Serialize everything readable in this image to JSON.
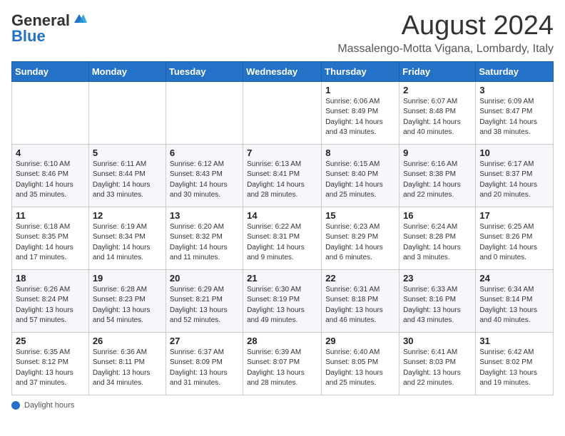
{
  "header": {
    "logo_line1": "General",
    "logo_line2": "Blue",
    "month_year": "August 2024",
    "location": "Massalengo-Motta Vigana, Lombardy, Italy"
  },
  "weekdays": [
    "Sunday",
    "Monday",
    "Tuesday",
    "Wednesday",
    "Thursday",
    "Friday",
    "Saturday"
  ],
  "weeks": [
    [
      {
        "day": "",
        "info": ""
      },
      {
        "day": "",
        "info": ""
      },
      {
        "day": "",
        "info": ""
      },
      {
        "day": "",
        "info": ""
      },
      {
        "day": "1",
        "info": "Sunrise: 6:06 AM\nSunset: 8:49 PM\nDaylight: 14 hours and 43 minutes."
      },
      {
        "day": "2",
        "info": "Sunrise: 6:07 AM\nSunset: 8:48 PM\nDaylight: 14 hours and 40 minutes."
      },
      {
        "day": "3",
        "info": "Sunrise: 6:09 AM\nSunset: 8:47 PM\nDaylight: 14 hours and 38 minutes."
      }
    ],
    [
      {
        "day": "4",
        "info": "Sunrise: 6:10 AM\nSunset: 8:46 PM\nDaylight: 14 hours and 35 minutes."
      },
      {
        "day": "5",
        "info": "Sunrise: 6:11 AM\nSunset: 8:44 PM\nDaylight: 14 hours and 33 minutes."
      },
      {
        "day": "6",
        "info": "Sunrise: 6:12 AM\nSunset: 8:43 PM\nDaylight: 14 hours and 30 minutes."
      },
      {
        "day": "7",
        "info": "Sunrise: 6:13 AM\nSunset: 8:41 PM\nDaylight: 14 hours and 28 minutes."
      },
      {
        "day": "8",
        "info": "Sunrise: 6:15 AM\nSunset: 8:40 PM\nDaylight: 14 hours and 25 minutes."
      },
      {
        "day": "9",
        "info": "Sunrise: 6:16 AM\nSunset: 8:38 PM\nDaylight: 14 hours and 22 minutes."
      },
      {
        "day": "10",
        "info": "Sunrise: 6:17 AM\nSunset: 8:37 PM\nDaylight: 14 hours and 20 minutes."
      }
    ],
    [
      {
        "day": "11",
        "info": "Sunrise: 6:18 AM\nSunset: 8:35 PM\nDaylight: 14 hours and 17 minutes."
      },
      {
        "day": "12",
        "info": "Sunrise: 6:19 AM\nSunset: 8:34 PM\nDaylight: 14 hours and 14 minutes."
      },
      {
        "day": "13",
        "info": "Sunrise: 6:20 AM\nSunset: 8:32 PM\nDaylight: 14 hours and 11 minutes."
      },
      {
        "day": "14",
        "info": "Sunrise: 6:22 AM\nSunset: 8:31 PM\nDaylight: 14 hours and 9 minutes."
      },
      {
        "day": "15",
        "info": "Sunrise: 6:23 AM\nSunset: 8:29 PM\nDaylight: 14 hours and 6 minutes."
      },
      {
        "day": "16",
        "info": "Sunrise: 6:24 AM\nSunset: 8:28 PM\nDaylight: 14 hours and 3 minutes."
      },
      {
        "day": "17",
        "info": "Sunrise: 6:25 AM\nSunset: 8:26 PM\nDaylight: 14 hours and 0 minutes."
      }
    ],
    [
      {
        "day": "18",
        "info": "Sunrise: 6:26 AM\nSunset: 8:24 PM\nDaylight: 13 hours and 57 minutes."
      },
      {
        "day": "19",
        "info": "Sunrise: 6:28 AM\nSunset: 8:23 PM\nDaylight: 13 hours and 54 minutes."
      },
      {
        "day": "20",
        "info": "Sunrise: 6:29 AM\nSunset: 8:21 PM\nDaylight: 13 hours and 52 minutes."
      },
      {
        "day": "21",
        "info": "Sunrise: 6:30 AM\nSunset: 8:19 PM\nDaylight: 13 hours and 49 minutes."
      },
      {
        "day": "22",
        "info": "Sunrise: 6:31 AM\nSunset: 8:18 PM\nDaylight: 13 hours and 46 minutes."
      },
      {
        "day": "23",
        "info": "Sunrise: 6:33 AM\nSunset: 8:16 PM\nDaylight: 13 hours and 43 minutes."
      },
      {
        "day": "24",
        "info": "Sunrise: 6:34 AM\nSunset: 8:14 PM\nDaylight: 13 hours and 40 minutes."
      }
    ],
    [
      {
        "day": "25",
        "info": "Sunrise: 6:35 AM\nSunset: 8:12 PM\nDaylight: 13 hours and 37 minutes."
      },
      {
        "day": "26",
        "info": "Sunrise: 6:36 AM\nSunset: 8:11 PM\nDaylight: 13 hours and 34 minutes."
      },
      {
        "day": "27",
        "info": "Sunrise: 6:37 AM\nSunset: 8:09 PM\nDaylight: 13 hours and 31 minutes."
      },
      {
        "day": "28",
        "info": "Sunrise: 6:39 AM\nSunset: 8:07 PM\nDaylight: 13 hours and 28 minutes."
      },
      {
        "day": "29",
        "info": "Sunrise: 6:40 AM\nSunset: 8:05 PM\nDaylight: 13 hours and 25 minutes."
      },
      {
        "day": "30",
        "info": "Sunrise: 6:41 AM\nSunset: 8:03 PM\nDaylight: 13 hours and 22 minutes."
      },
      {
        "day": "31",
        "info": "Sunrise: 6:42 AM\nSunset: 8:02 PM\nDaylight: 13 hours and 19 minutes."
      }
    ]
  ],
  "footer": {
    "note": "Daylight hours"
  }
}
